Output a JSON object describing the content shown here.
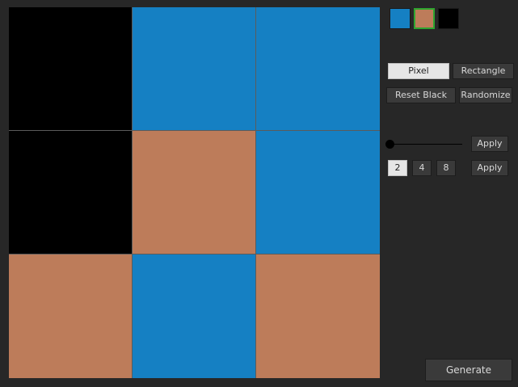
{
  "colors": {
    "blue": "#1580c3",
    "tan": "#bd7c5a",
    "black": "#000000",
    "background": "#272727"
  },
  "grid": {
    "rows": 3,
    "cols": 3,
    "cells": [
      [
        "black",
        "blue",
        "blue"
      ],
      [
        "black",
        "tan",
        "blue"
      ],
      [
        "tan",
        "blue",
        "tan"
      ]
    ]
  },
  "palette": [
    {
      "color": "blue",
      "selected": false
    },
    {
      "color": "tan",
      "selected": true
    },
    {
      "color": "black",
      "selected": false
    }
  ],
  "tools": {
    "pixel_label": "Pixel",
    "rectangle_label": "Rectangle",
    "active_tool": "pixel"
  },
  "actions": {
    "reset_black_label": "Reset Black",
    "randomize_label": "Randomize",
    "apply_slider_label": "Apply",
    "apply_size_label": "Apply",
    "generate_label": "Generate"
  },
  "size_options": [
    {
      "label": "2",
      "selected": true
    },
    {
      "label": "4",
      "selected": false
    },
    {
      "label": "8",
      "selected": false
    }
  ],
  "slider": {
    "value": 0
  }
}
